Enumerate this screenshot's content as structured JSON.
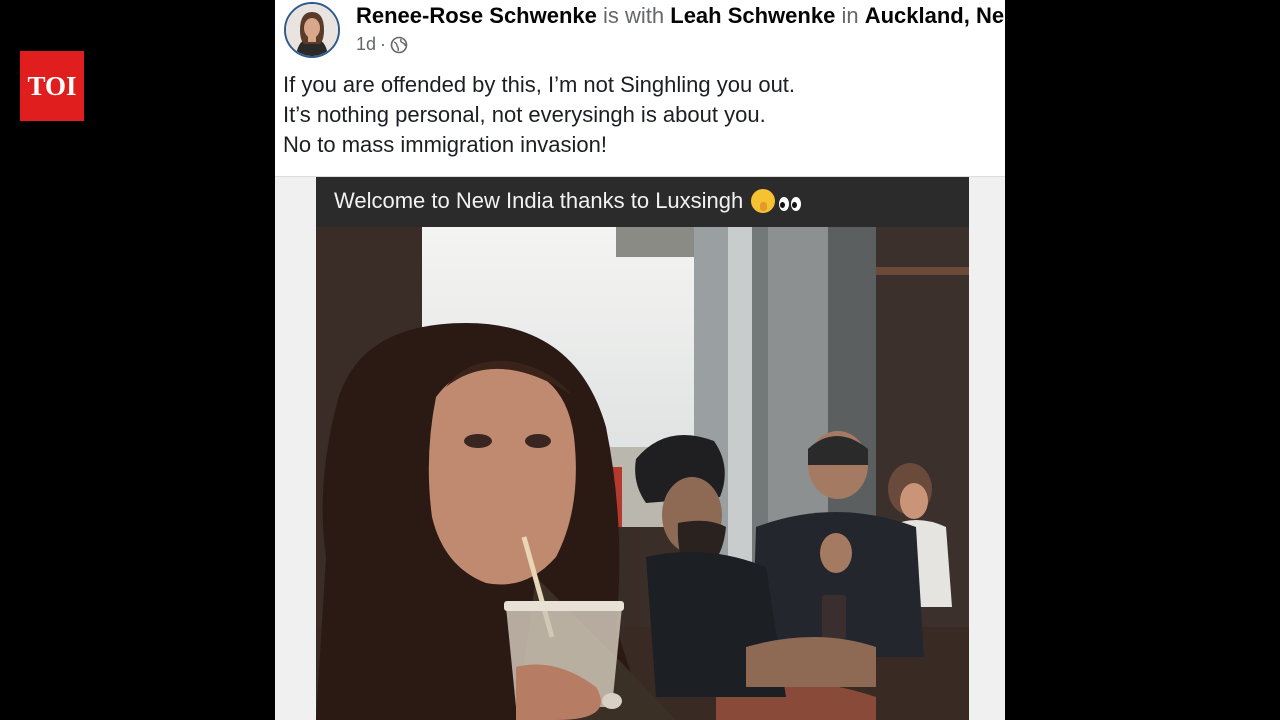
{
  "branding": {
    "logo_text": "TOI",
    "logo_color": "#e01e1e"
  },
  "post": {
    "author_name": "Renee-Rose Schwenke",
    "with_word": "is with",
    "tagged_name": "Leah Schwenke",
    "in_word": "in",
    "location": "Auckland, Ne...",
    "time": "1d",
    "separator": "·",
    "audience_icon": "globe-icon",
    "text_lines": [
      "If you are offended by this, I’m not Singhling you out.",
      "It’s nothing personal, not everysingh is about you.",
      "No to mass immigration invasion!"
    ]
  },
  "shared_image": {
    "caption": "Welcome to New India thanks to Luxsingh",
    "emojis": [
      "shushing-face-emoji",
      "eyes-emoji"
    ]
  },
  "colors": {
    "page_background": "#000000",
    "card_background": "#ffffff",
    "name_text": "#050505",
    "secondary_text": "#65676b"
  }
}
